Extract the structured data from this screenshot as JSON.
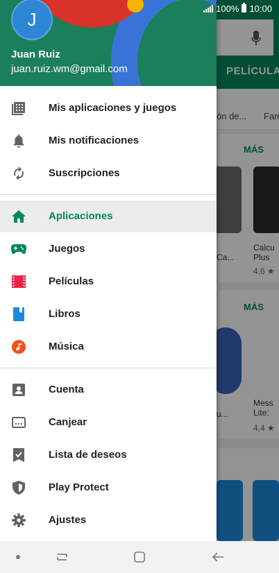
{
  "status_bar": {
    "battery": "100%",
    "time": "10:00"
  },
  "background_app": {
    "tab_peliculas": "PELÍCULA",
    "chip_1": "ón de...",
    "chip_2": "Fam",
    "section_more_1": "MÁS",
    "section_more_2": "MÁS",
    "app_1_title": "Calcu Plus",
    "app_1_title_short": "Ca...",
    "app_1_rating": "4,6 ★",
    "app_2_title": "Mess Lite:",
    "app_2_title_short": "u...",
    "app_2_rating": "4,4 ★",
    "colors": {
      "primary": "#01875f"
    }
  },
  "drawer": {
    "user": {
      "initial": "J",
      "name": "Juan Ruiz",
      "email": "juan.ruiz.wm@gmail.com"
    },
    "group_1": [
      {
        "label": "Mis aplicaciones y juegos",
        "icon": "apps-grid-icon"
      },
      {
        "label": "Mis notificaciones",
        "icon": "bell-icon"
      },
      {
        "label": "Suscripciones",
        "icon": "refresh-icon"
      }
    ],
    "group_2": [
      {
        "label": "Aplicaciones",
        "icon": "home-icon",
        "active": true
      },
      {
        "label": "Juegos",
        "icon": "gamepad-icon"
      },
      {
        "label": "Películas",
        "icon": "film-icon"
      },
      {
        "label": "Libros",
        "icon": "book-icon"
      },
      {
        "label": "Música",
        "icon": "music-icon"
      }
    ],
    "group_3": [
      {
        "label": "Cuenta",
        "icon": "account-icon"
      },
      {
        "label": "Canjear",
        "icon": "redeem-icon"
      },
      {
        "label": "Lista de deseos",
        "icon": "wishlist-icon"
      },
      {
        "label": "Play Protect",
        "icon": "shield-icon"
      },
      {
        "label": "Ajustes",
        "icon": "gear-icon"
      }
    ],
    "colors": {
      "active": "#01875f",
      "games": "#01875f",
      "movies": "#e8244a",
      "books": "#1a8bdc",
      "music": "#f5511e",
      "icon_gray": "#5f6368"
    }
  },
  "navbar": {
    "icons": [
      "dot-icon",
      "recents-icon",
      "home-square-icon",
      "back-icon"
    ]
  }
}
